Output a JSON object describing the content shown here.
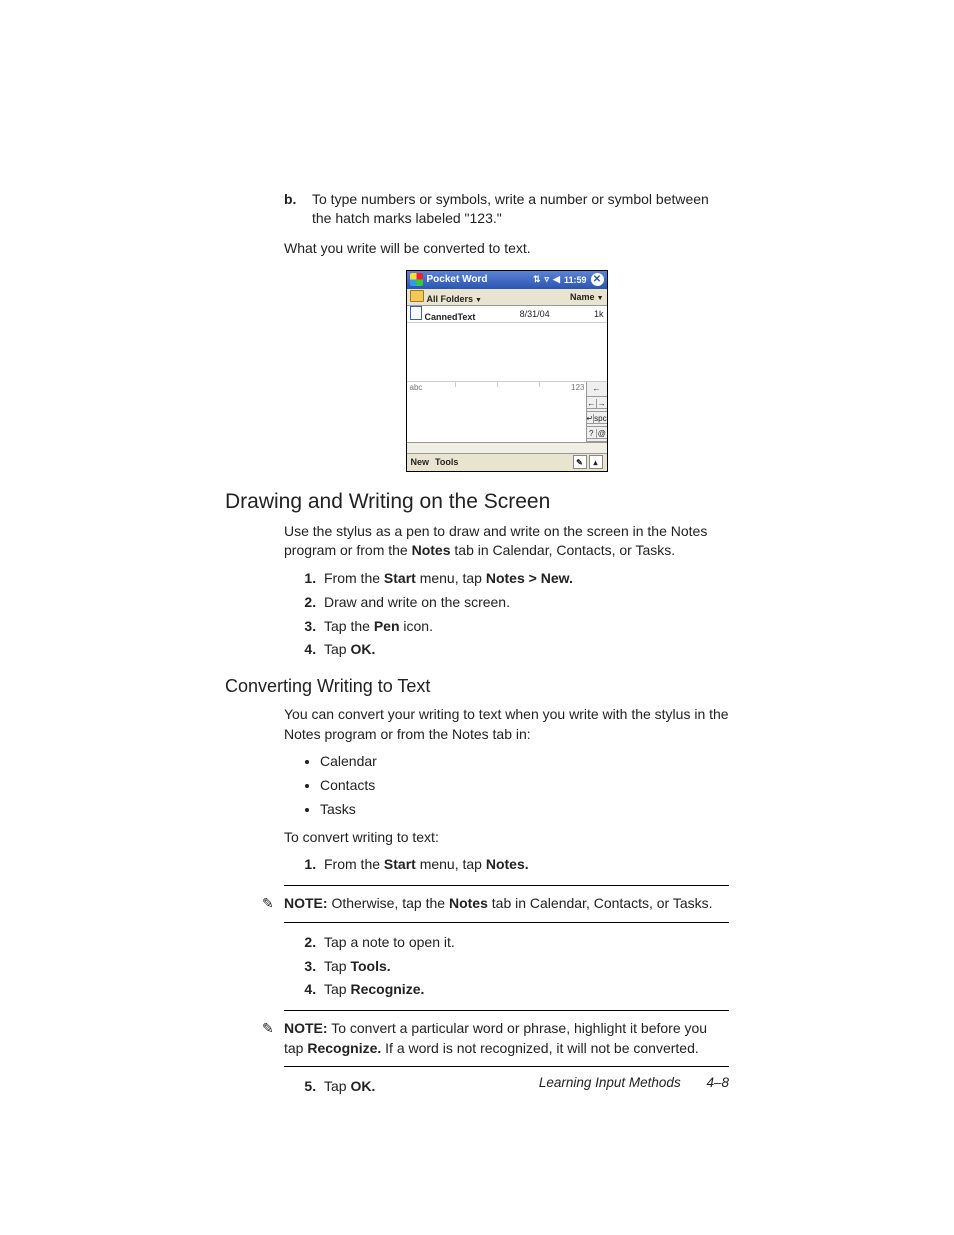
{
  "stepB": {
    "marker": "b.",
    "text": "To type numbers or symbols, write a number or symbol between the hatch marks labeled \"123.\""
  },
  "followup": "What you write will be converted to text.",
  "screenshot": {
    "title": "Pocket Word",
    "time": "11:59",
    "folderbar_left": "All Folders",
    "folderbar_right": "Name",
    "filerow": {
      "name": "CannedText",
      "date": "8/31/04",
      "size": "1k"
    },
    "input_left_label": "abc",
    "input_right_label": "123",
    "sidekeys": {
      "back": "←",
      "left": "←",
      "right": "→",
      "enter": "↵",
      "spc": "spc",
      "q": "?",
      "at": "@"
    },
    "menubar": {
      "new": "New",
      "tools": "Tools"
    }
  },
  "section1": {
    "title": "Drawing and Writing on the Screen",
    "intro_pre": "Use the stylus as a pen to draw and write on the screen in the Notes program or from the ",
    "intro_bold": "Notes",
    "intro_post": " tab in Calendar, Contacts, or Tasks.",
    "steps": [
      {
        "pre": "From the ",
        "b1": "Start",
        "mid": " menu, tap ",
        "b2": "Notes > New."
      },
      {
        "pre": "Draw and write on the screen."
      },
      {
        "pre": "Tap the ",
        "b1": "Pen",
        "mid": " icon."
      },
      {
        "pre": "Tap ",
        "b1": "OK."
      }
    ]
  },
  "section2": {
    "title": "Converting Writing to Text",
    "intro": "You can convert your writing to text when you write with the stylus in the Notes program or from the Notes tab in:",
    "bullets": [
      "Calendar",
      "Contacts",
      "Tasks"
    ],
    "lead": "To convert writing to text:",
    "step1": {
      "pre": "From the ",
      "b1": "Start",
      "mid": " menu, tap ",
      "b2": "Notes."
    },
    "note1": {
      "label": "NOTE:",
      "pre": " Otherwise, tap the ",
      "b1": "Notes",
      "post": " tab in Calendar, Contacts, or Tasks."
    },
    "step2": "Tap a note to open it.",
    "step3": {
      "pre": "Tap ",
      "b1": "Tools."
    },
    "step4": {
      "pre": "Tap ",
      "b1": "Recognize."
    },
    "note2": {
      "label": "NOTE:",
      "pre": " To convert a particular word or phrase, highlight it before you tap ",
      "b1": "Recognize.",
      "post": " If a word is not recognized, it will not be converted."
    },
    "step5": {
      "pre": "Tap ",
      "b1": "OK."
    }
  },
  "footer": {
    "chapter": "Learning Input Methods",
    "page": "4–8"
  }
}
